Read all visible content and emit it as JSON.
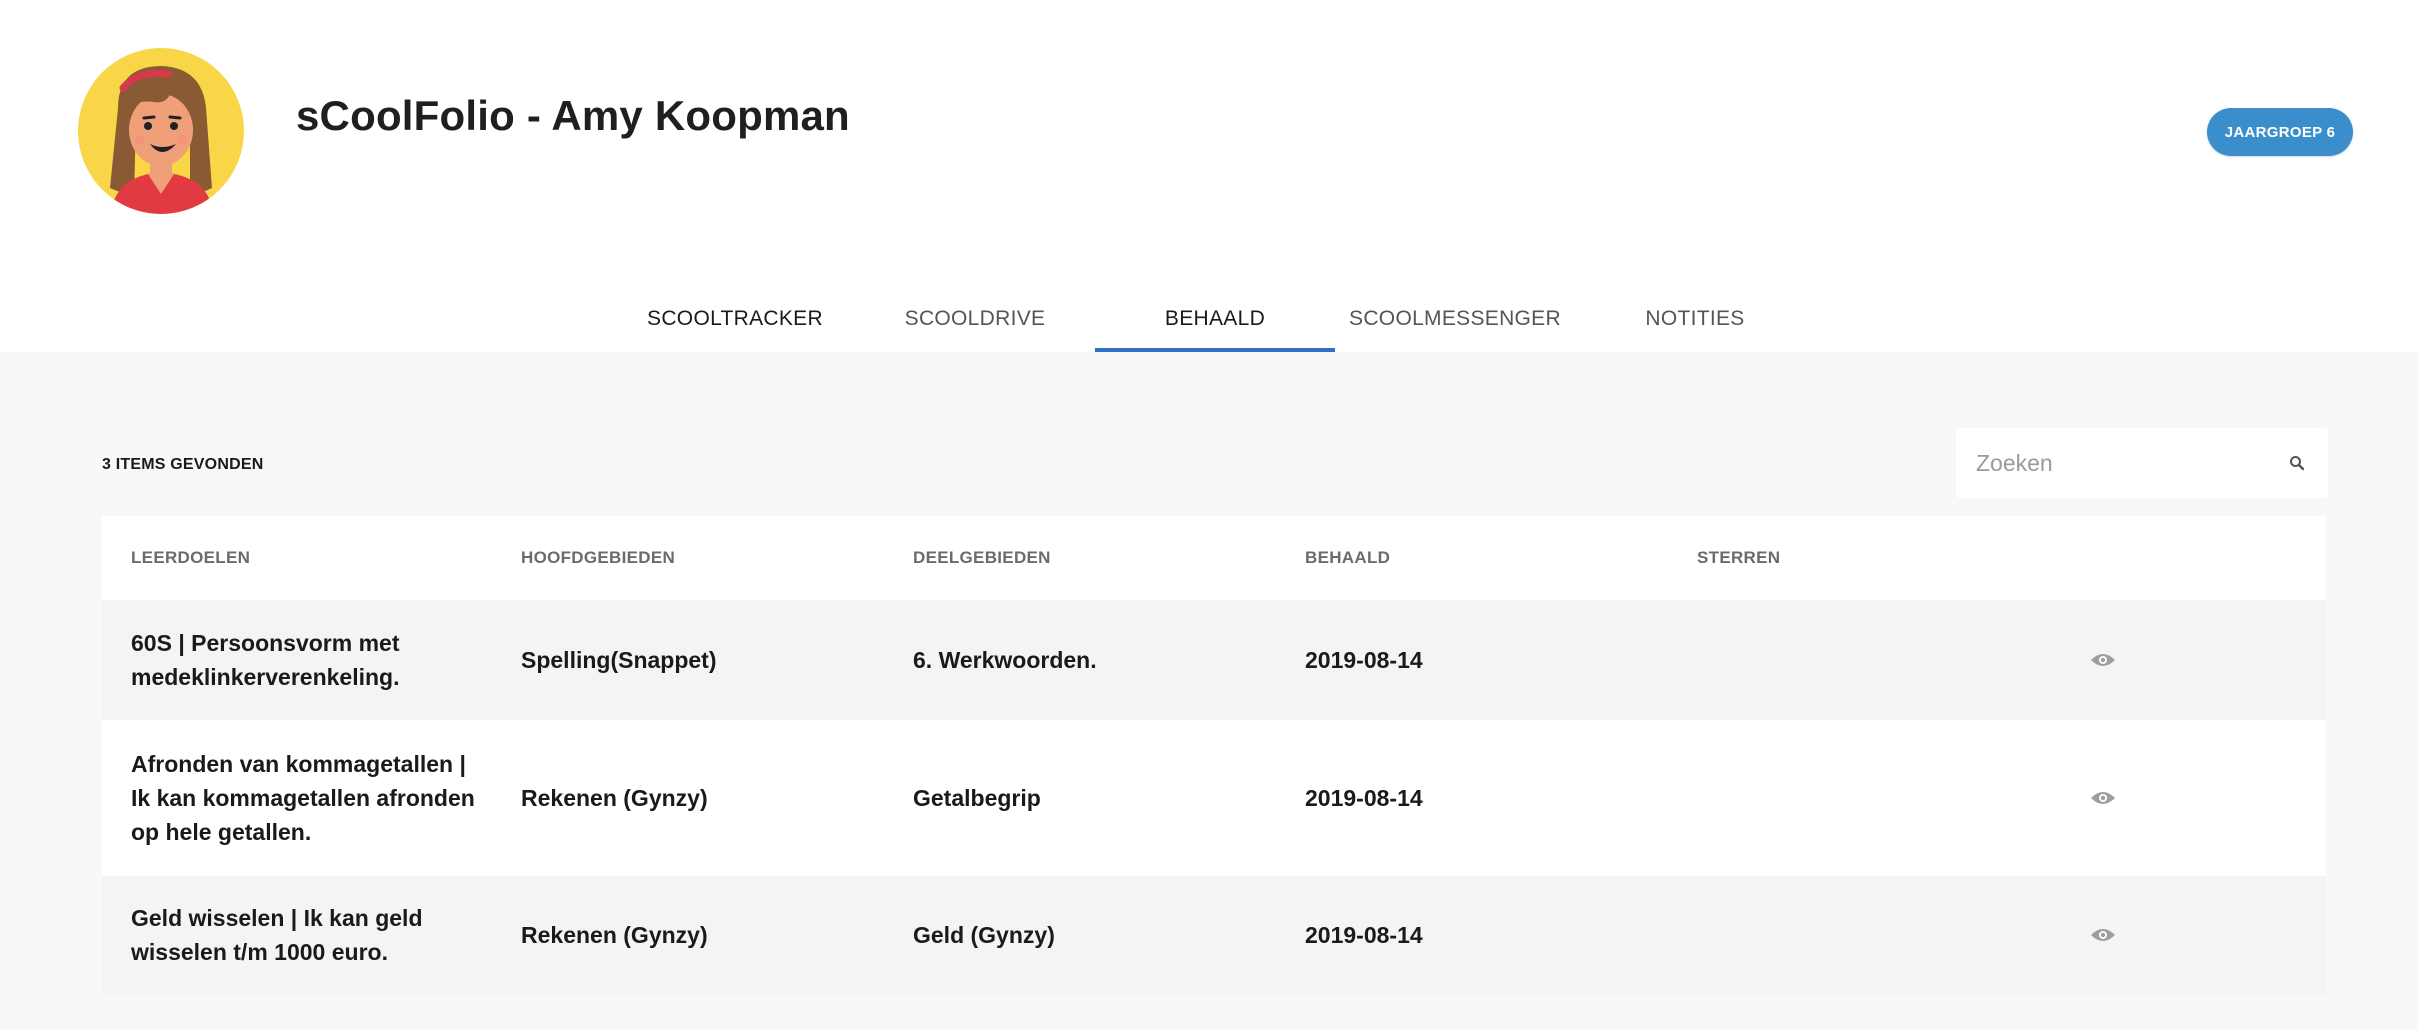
{
  "header": {
    "title": "sCoolFolio - Amy Koopman",
    "grade_badge": "JAARGROEP 6"
  },
  "tabs": [
    {
      "label": "SCOOLTRACKER"
    },
    {
      "label": "SCOOLDRIVE"
    },
    {
      "label": "BEHAALD"
    },
    {
      "label": "SCOOLMESSENGER"
    },
    {
      "label": "NOTITIES"
    }
  ],
  "results": {
    "count_label": "3 ITEMS GEVONDEN"
  },
  "search": {
    "placeholder": "Zoeken",
    "icon": "search-icon"
  },
  "table": {
    "headers": [
      "LEERDOELEN",
      "HOOFDGEBIEDEN",
      "DEELGEBIEDEN",
      "BEHAALD",
      "STERREN"
    ],
    "rows": [
      {
        "leerdoel": "60S | Persoonsvorm met medeklinkerverenkeling.",
        "hoofdgebied": "Spelling(Snappet)",
        "deelgebied": "6. Werkwoorden.",
        "behaald": "2019-08-14",
        "sterren": "",
        "action_icon": "eye-icon"
      },
      {
        "leerdoel": "Afronden van kommagetallen | Ik kan kommagetallen afronden op hele getallen.",
        "hoofdgebied": "Rekenen (Gynzy)",
        "deelgebied": "Getalbegrip",
        "behaald": "2019-08-14",
        "sterren": "",
        "action_icon": "eye-icon"
      },
      {
        "leerdoel": "Geld wisselen | Ik kan geld wisselen t/m 1000 euro.",
        "hoofdgebied": "Rekenen (Gynzy)",
        "deelgebied": "Geld (Gynzy)",
        "behaald": "2019-08-14",
        "sterren": "",
        "action_icon": "eye-icon"
      }
    ]
  },
  "colors": {
    "accent": "#2f72c4",
    "badge": "#3a8ecb",
    "background": "#f8f8f8",
    "avatar_bg": "#f9d648"
  }
}
